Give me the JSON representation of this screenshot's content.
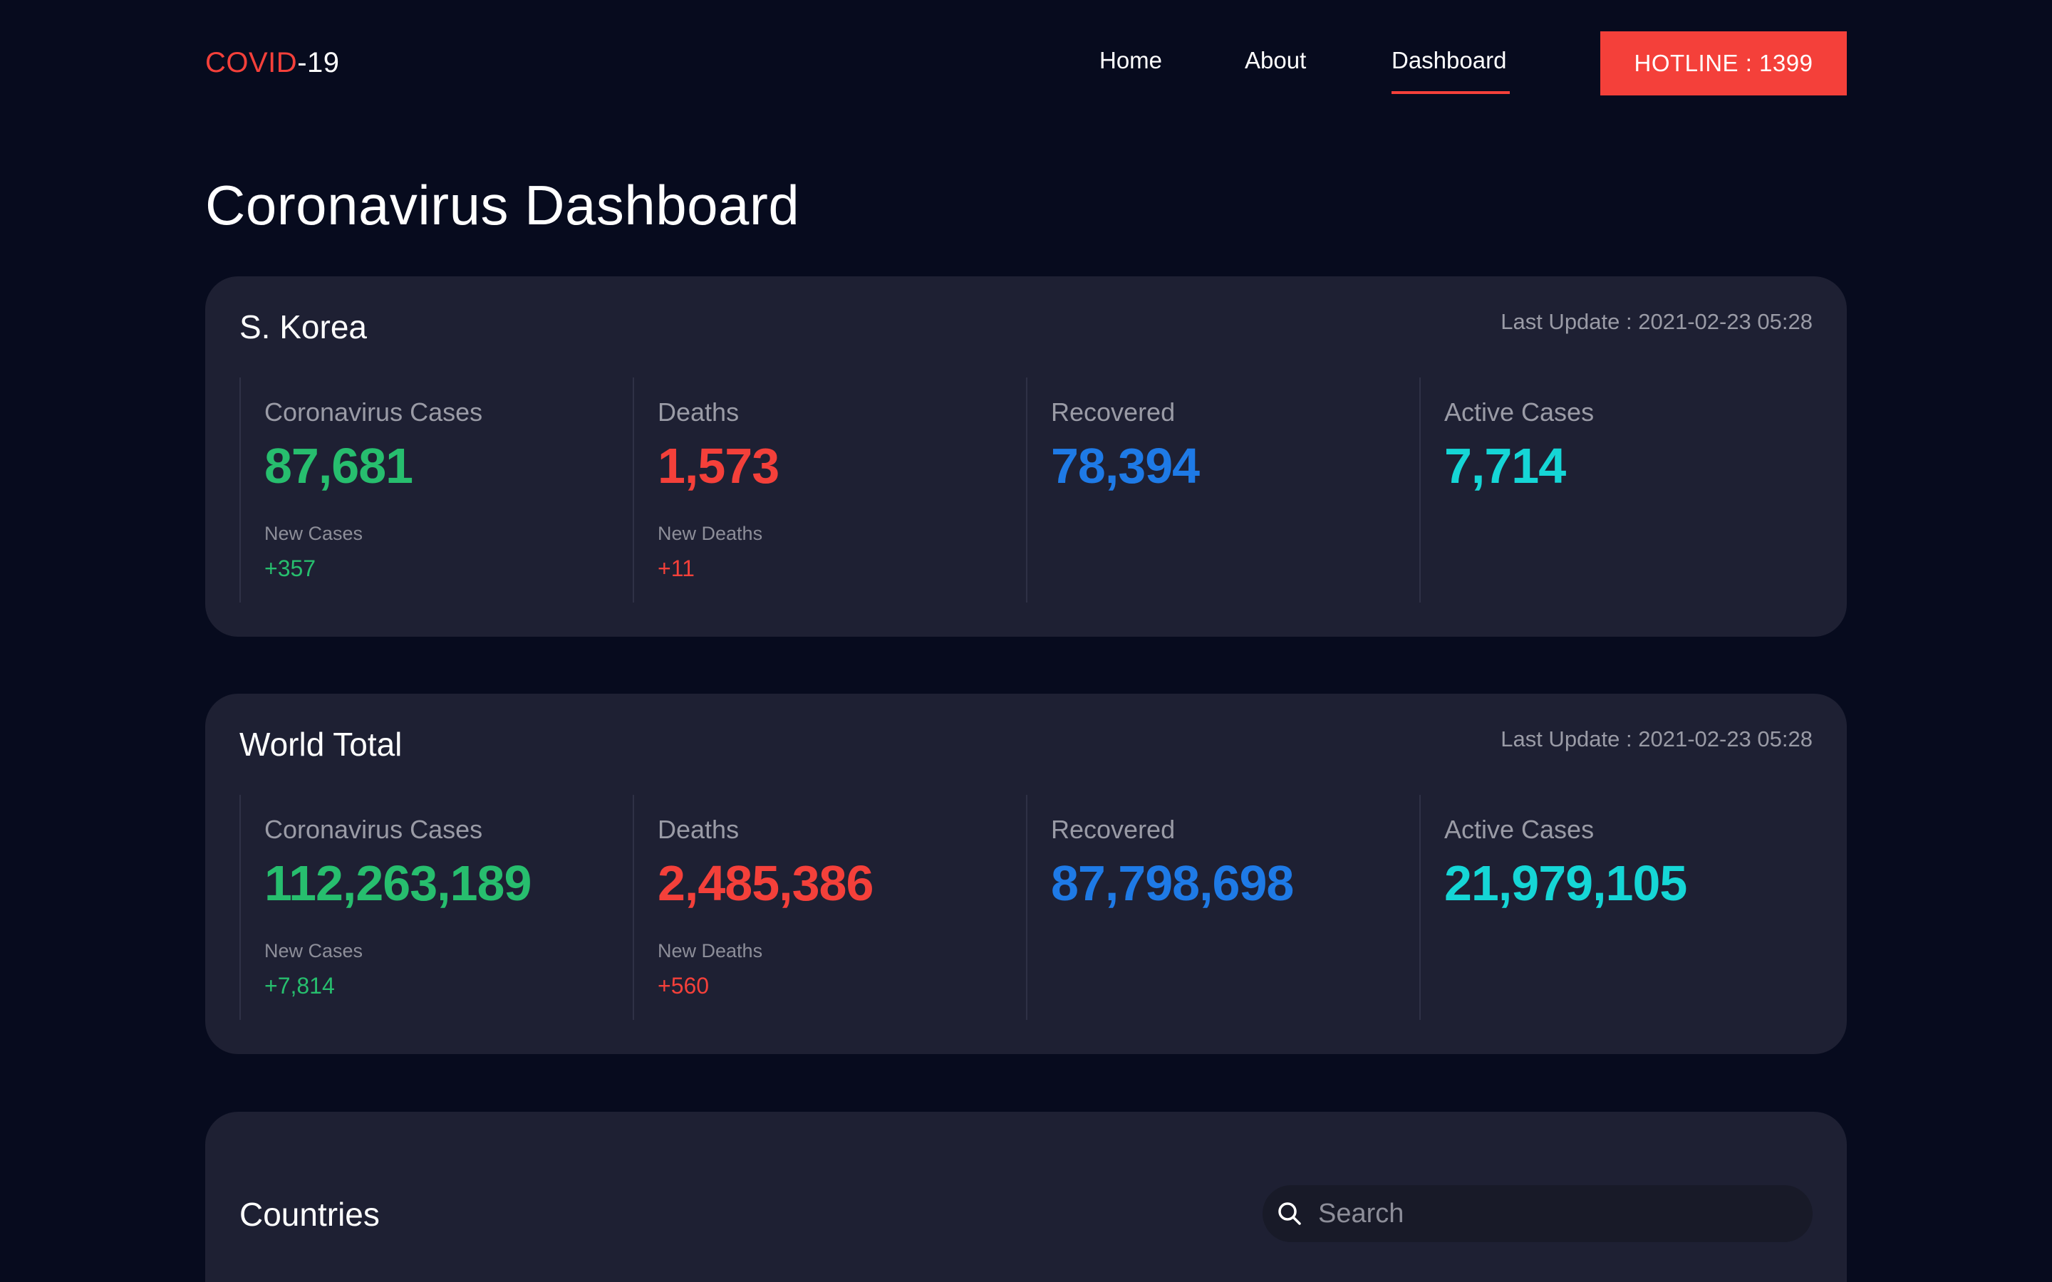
{
  "header": {
    "logo_part1": "COVID",
    "logo_part2": "-19",
    "nav": [
      {
        "label": "Home"
      },
      {
        "label": "About"
      },
      {
        "label": "Dashboard",
        "active": true
      }
    ],
    "hotline_label": "HOTLINE : 1399"
  },
  "page_title": "Coronavirus Dashboard",
  "korea": {
    "title": "S. Korea",
    "last_update": "Last Update : 2021-02-23 05:28",
    "stats": [
      {
        "label": "Coronavirus Cases",
        "value": "87,681",
        "sub_label": "New Cases",
        "sub_value": "+357"
      },
      {
        "label": "Deaths",
        "value": "1,573",
        "sub_label": "New Deaths",
        "sub_value": "+11"
      },
      {
        "label": "Recovered",
        "value": "78,394"
      },
      {
        "label": "Active Cases",
        "value": "7,714"
      }
    ]
  },
  "world": {
    "title": "World Total",
    "last_update": "Last Update : 2021-02-23 05:28",
    "stats": [
      {
        "label": "Coronavirus Cases",
        "value": "112,263,189",
        "sub_label": "New Cases",
        "sub_value": "+7,814"
      },
      {
        "label": "Deaths",
        "value": "2,485,386",
        "sub_label": "New Deaths",
        "sub_value": "+560"
      },
      {
        "label": "Recovered",
        "value": "87,798,698"
      },
      {
        "label": "Active Cases",
        "value": "21,979,105"
      }
    ]
  },
  "countries": {
    "title": "Countries",
    "search_placeholder": "Search"
  },
  "colors": {
    "background": "#070b1e",
    "card": "#1e2033",
    "accent_red": "#f4403a",
    "cases_green": "#27be6e",
    "recovered_blue": "#1e7ae6",
    "active_cyan": "#15d6d6"
  }
}
